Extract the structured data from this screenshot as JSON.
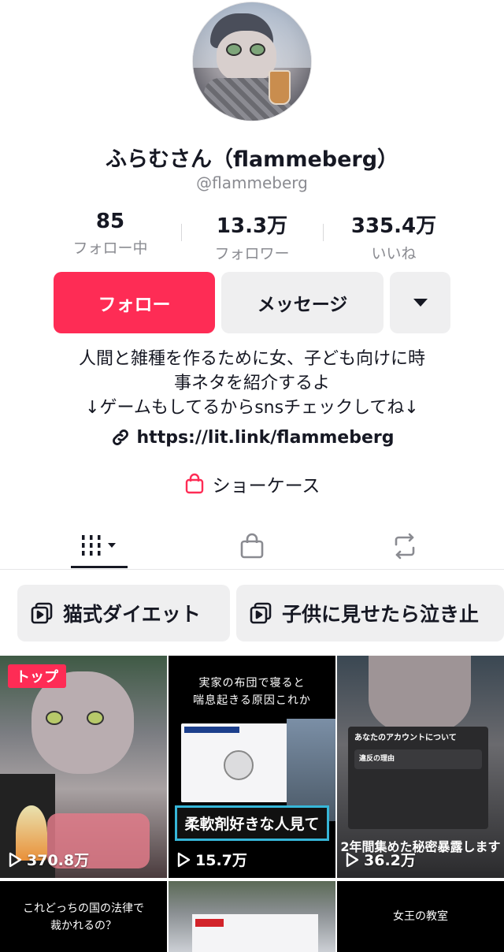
{
  "profile": {
    "display_name": "ふらむさん（flammeberg）",
    "handle": "@flammeberg"
  },
  "stats": [
    {
      "value": "85",
      "label": "フォロー中"
    },
    {
      "value": "13.3万",
      "label": "フォロワー"
    },
    {
      "value": "335.4万",
      "label": "いいね"
    }
  ],
  "actions": {
    "follow_label": "フォロー",
    "message_label": "メッセージ"
  },
  "bio": {
    "line1": "人間と雑種を作るために女、子ども向けに時",
    "line2": "事ネタを紹介するよ",
    "line3": "↓ゲームもしてるからsnsチェックしてね↓",
    "link": "https://lit.link/flammeberg"
  },
  "showcase_label": "ショーケース",
  "playlists": [
    {
      "label": "猫式ダイエット"
    },
    {
      "label": "子供に見せたら泣き止"
    }
  ],
  "videos": [
    {
      "views": "370.8万",
      "badge": "トップ"
    },
    {
      "views": "15.7万",
      "overlay_top": "実家の布団で寝ると\n喘息起きる原因これか",
      "overlay_box": "柔軟剤好きな人見て"
    },
    {
      "views": "36.2万",
      "notice_title": "あなたのアカウントについて",
      "notice_sub": "違反の理由",
      "overlay_bottom": "2年間集めた秘密暴露します"
    },
    {
      "overlay_top": "これどっちの国の法律で\n裁かれるの？"
    },
    {
      "overlay_top": ""
    },
    {
      "overlay_top": "女王の教室"
    }
  ],
  "colors": {
    "accent": "#fe2c55",
    "text": "#161823",
    "muted": "#8a8b91",
    "button_gray": "#efeff0"
  }
}
